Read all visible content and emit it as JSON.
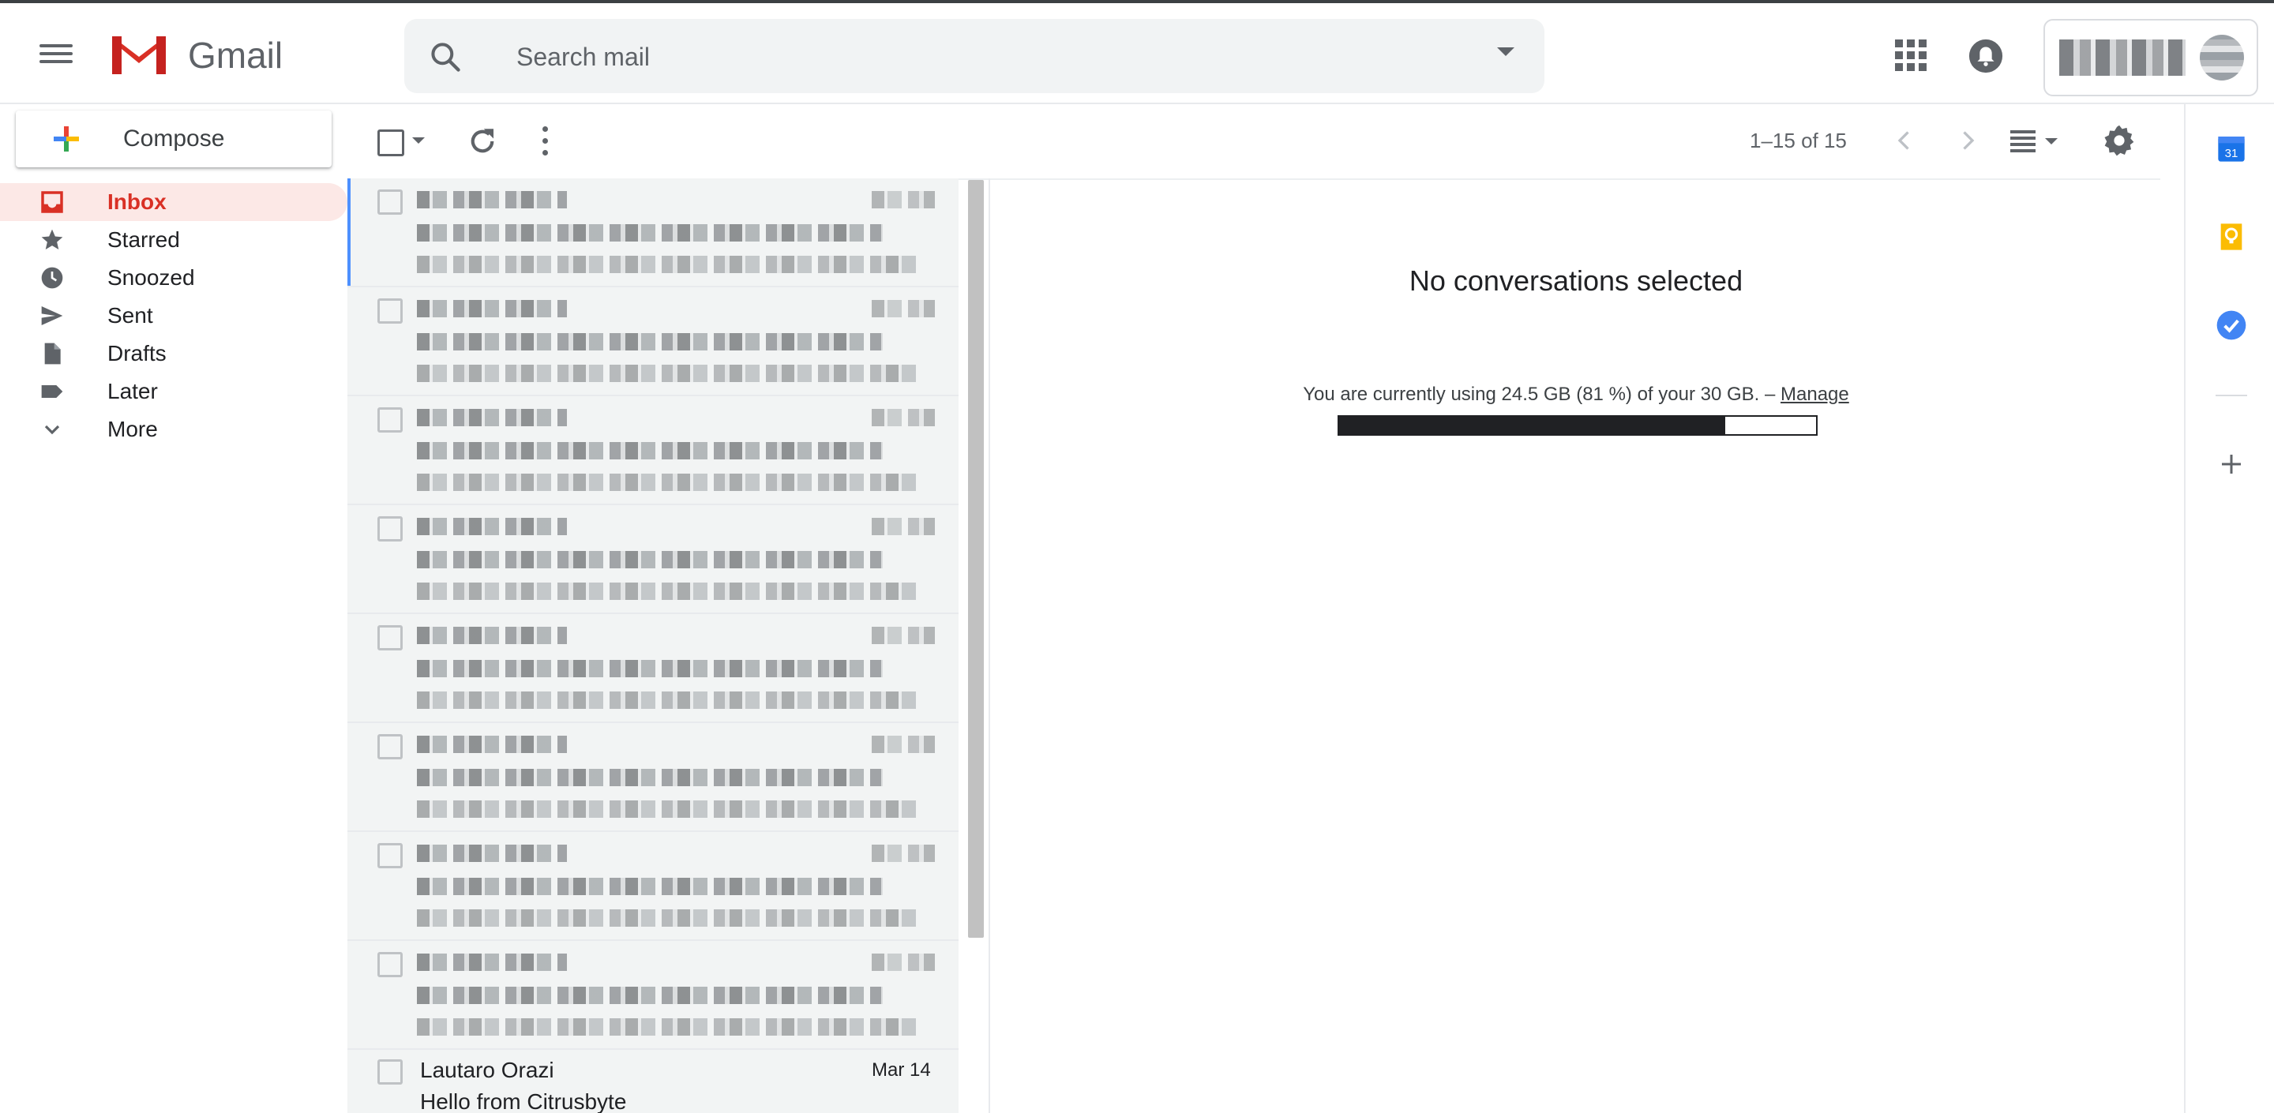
{
  "app": {
    "name": "Gmail"
  },
  "search": {
    "placeholder": "Search mail"
  },
  "compose": {
    "label": "Compose"
  },
  "nav": {
    "items": [
      {
        "label": "Inbox",
        "icon": "inbox-icon",
        "active": true
      },
      {
        "label": "Starred",
        "icon": "star-icon"
      },
      {
        "label": "Snoozed",
        "icon": "clock-icon"
      },
      {
        "label": "Sent",
        "icon": "send-icon"
      },
      {
        "label": "Drafts",
        "icon": "draft-icon"
      },
      {
        "label": "Later",
        "icon": "label-icon"
      },
      {
        "label": "More",
        "icon": "chevron-down-icon"
      }
    ]
  },
  "toolbar": {
    "count": "1–15 of 15"
  },
  "messages": [
    {
      "sender": "Lautaro Orazi",
      "subject": "Hello from Citrusbyte",
      "date": "Mar 14"
    }
  ],
  "preview": {
    "empty_title": "No conversations selected",
    "storage_text": "You are currently using 24.5 GB (81 %) of your 30 GB. –",
    "manage_link": "Manage",
    "storage_used_fraction": 0.81
  },
  "colors": {
    "accent_red": "#d93025",
    "active_bg": "#fce8e6",
    "selected_row": "#4d90fe"
  }
}
